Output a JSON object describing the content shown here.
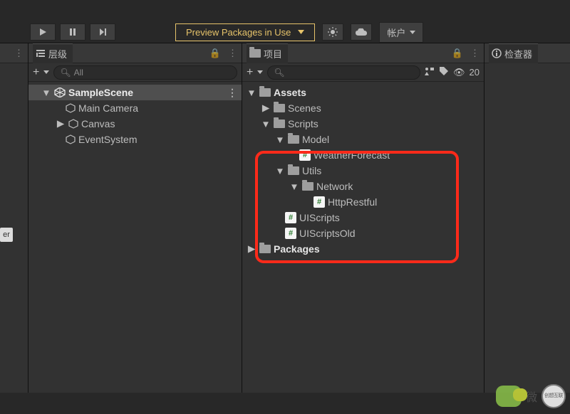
{
  "topbar": {
    "preview_label": "Preview Packages in Use",
    "account_label": "帐户"
  },
  "hierarchy_panel": {
    "tab_label": "层级",
    "search_text": "All",
    "tree": {
      "scene": "SampleScene",
      "items": [
        "Main Camera",
        "Canvas",
        "EventSystem"
      ]
    }
  },
  "project_panel": {
    "tab_label": "项目",
    "hidden_count": "20",
    "tree": {
      "assets": "Assets",
      "scenes": "Scenes",
      "scripts": "Scripts",
      "model": "Model",
      "weather": "WeatherForecast",
      "utils": "Utils",
      "network": "Network",
      "http": "HttpRestful",
      "uiscripts": "UIScripts",
      "uiscriptsold": "UIScriptsOld",
      "packages": "Packages"
    }
  },
  "inspector_panel": {
    "tab_label": "检查器"
  },
  "watermark": {
    "wechat_suffix": "微",
    "brand": "创想互联"
  },
  "side_button": "er"
}
